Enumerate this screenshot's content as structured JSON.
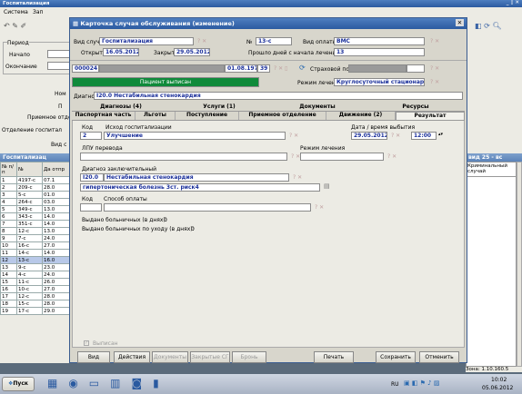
{
  "app": {
    "title": "Госпитализация",
    "menu": [
      "Система",
      "Зап"
    ],
    "wincontrols": [
      "_",
      "▯",
      "✕"
    ]
  },
  "left": {
    "period": "Период",
    "start": "Начало",
    "end": "Окончание",
    "label_no": "Ном",
    "label_p": "П",
    "admission": "Приемное отде",
    "dept": "Отделение госпитал",
    "type": "Вид с",
    "grid_title": "Госпитализац",
    "grid_hdr": [
      "№ п/п",
      "№",
      "Да отпр"
    ],
    "rows": [
      [
        "1",
        "4197-с",
        "07.1"
      ],
      [
        "2",
        "209-с",
        "28.0"
      ],
      [
        "3",
        "5-с",
        "01.0"
      ],
      [
        "4",
        "264-с",
        "03.0"
      ],
      [
        "5",
        "349-с",
        "13.0"
      ],
      [
        "6",
        "343-с",
        "14.0"
      ],
      [
        "7",
        "351-с",
        "14.0"
      ],
      [
        "8",
        "12-с",
        "13.0"
      ],
      [
        "9",
        "7-с",
        "24.0"
      ],
      [
        "10",
        "16-с",
        "27.0"
      ],
      [
        "11",
        "14-с",
        "14.0"
      ],
      [
        "12",
        "13-с",
        "16.0"
      ],
      [
        "13",
        "9-с",
        "23.0"
      ],
      [
        "14",
        "4-с",
        "24.0"
      ],
      [
        "15",
        "11-с",
        "26.0"
      ],
      [
        "16",
        "10-с",
        "27.0"
      ],
      [
        "17",
        "12-с",
        "28.0"
      ],
      [
        "18",
        "15-с",
        "28.0"
      ],
      [
        "19",
        "17-с",
        "29.0"
      ]
    ]
  },
  "right": {
    "grid_head": "вид 25 - вс",
    "col": "Криминальный случай",
    "footer": "Зона: 1.10.160.5"
  },
  "card": {
    "title": "Карточка случая обслуживания (изменение)",
    "vid_label": "Вид случая",
    "vid": "Госпитализация",
    "num_label": "№",
    "num": "13-с",
    "pay_label": "Вид оплаты",
    "pay": "ВМС",
    "open_label": "Открыт",
    "open": "16.05.2012",
    "close_label": "Закрыт",
    "close": "29.05.2012",
    "days_label": "Прошло дней с начала лечения",
    "days": "13",
    "patient_id": "000024",
    "patient_dob": "01.08.1972",
    "patient_age": "39",
    "policy_label": "Страховой полис",
    "status": "Пациент выписан",
    "mode_label": "Режим лечения",
    "mode": "Круглосуточный стационар",
    "diag_label": "Диагноз",
    "diag": "I20.0 Нестабильная стенокардия",
    "tabs1": [
      "Диагнозы (4)",
      "Услуги (1)",
      "Документы",
      "Ресурсы"
    ],
    "tabs2": [
      "Паспортная часть",
      "Льготы",
      "Поступление",
      "Приемное отделение",
      "Движение (2)",
      "Результат"
    ],
    "kod_label": "Код",
    "outcome_label": "Исход госпитализации",
    "kod": "2",
    "outcome": "Улучшение",
    "date_label": "Дата / время выбытия",
    "date": "29.05.2012",
    "time": "12:00",
    "transfer_label": "ЛПУ перевода",
    "mode2_label": "Режим лечения",
    "final_label": "Диагноз заключительный",
    "final_code": "I20.0",
    "final_name": "Нестабильная стенокардия",
    "final_text": "гипертоническая болезнь 3ст. риск4",
    "kod2_label": "Код",
    "payment_label": "Способ оплаты",
    "sick_label": "Выдано больничных (в днях):",
    "sick": "0",
    "care_label": "Выдано больничных по уходу (в днях):",
    "care": "0",
    "checkbox": "Выписан",
    "buttons": [
      "Вид",
      "Действия",
      "Документы",
      "Закрытые СГ",
      "Бронь",
      "Печать",
      "Сохранить",
      "Отменить"
    ]
  },
  "taskbar": {
    "start": "Пуск",
    "lang": "RU",
    "time": "10:02",
    "date": "05.06.2012"
  },
  "colors": {
    "title": "#2b5aa0",
    "field_text": "#1a2f9a",
    "status_bg": "#0f8a3a"
  }
}
